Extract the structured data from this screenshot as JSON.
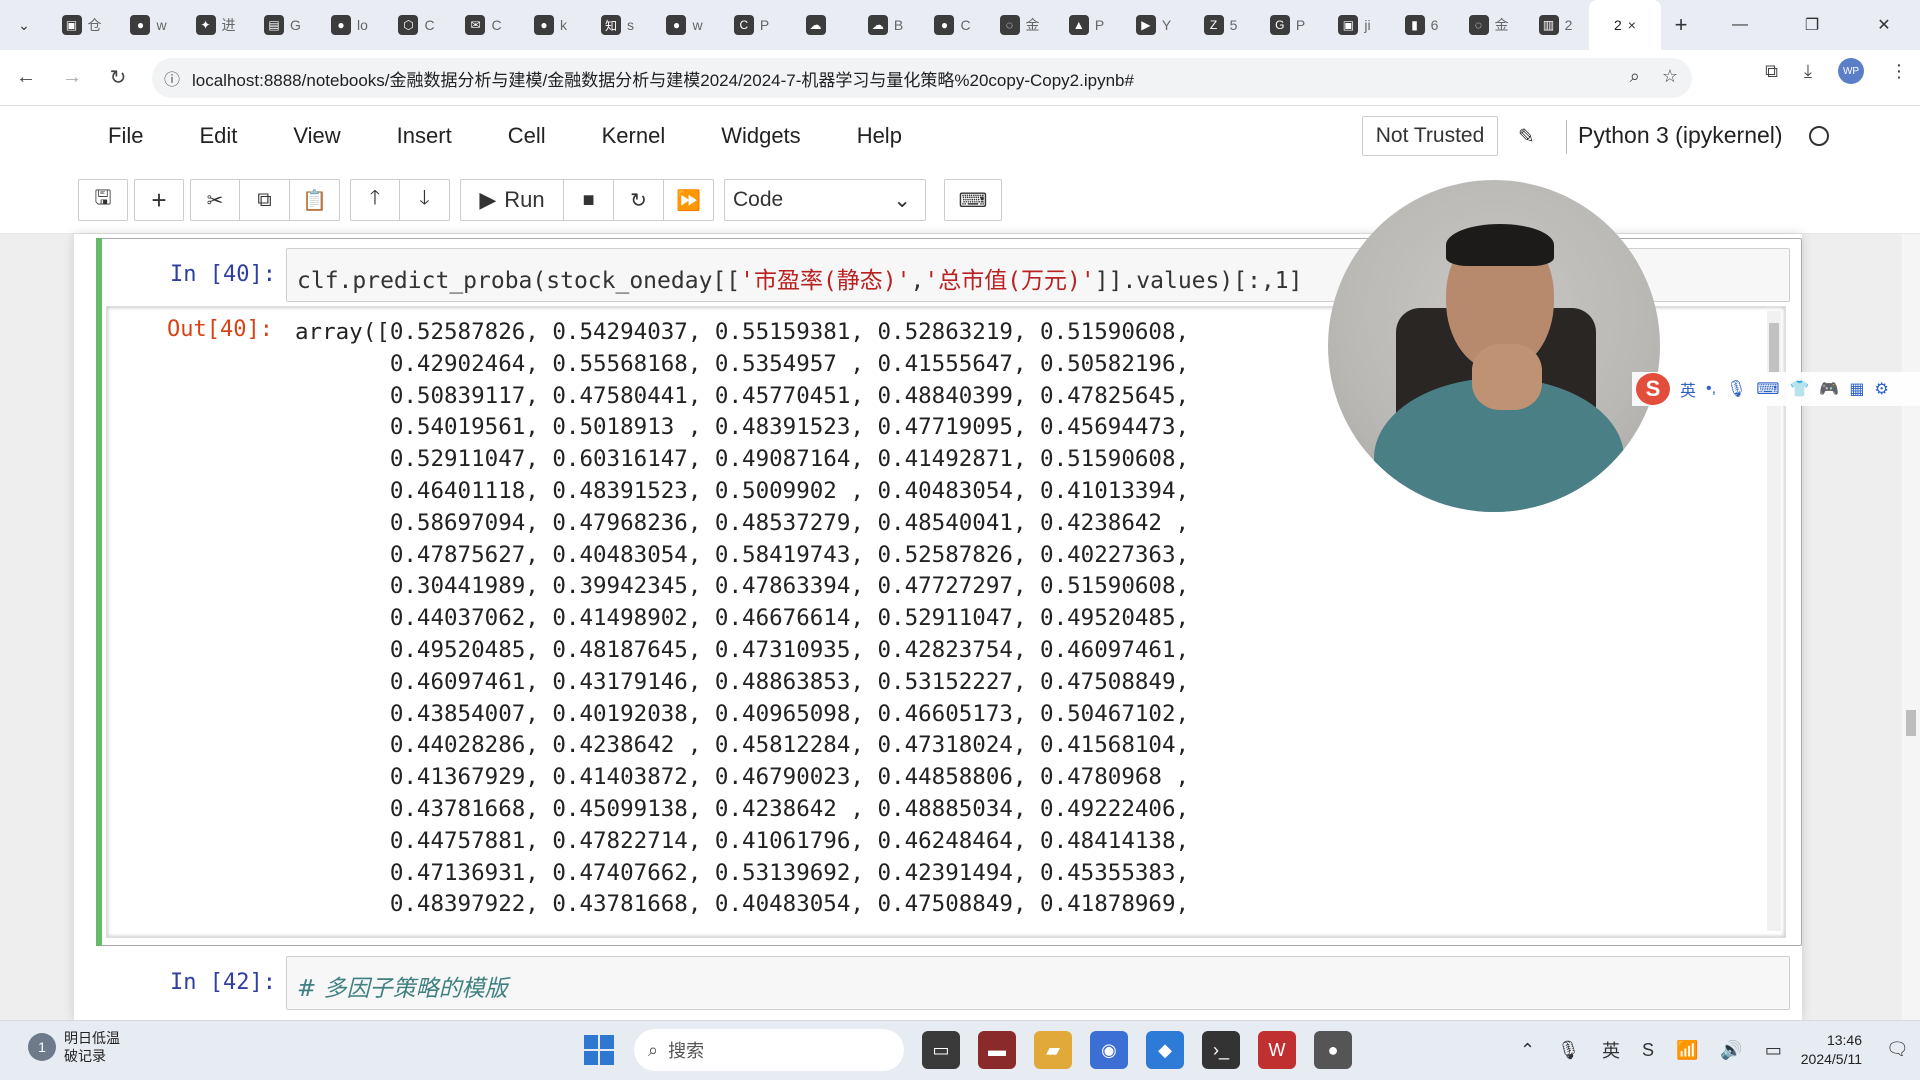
{
  "browser": {
    "tabs": [
      {
        "icon": "calendar",
        "label": "仓"
      },
      {
        "icon": "github",
        "label": "w"
      },
      {
        "icon": "tool",
        "label": "进"
      },
      {
        "icon": "generic",
        "label": "G"
      },
      {
        "icon": "github",
        "label": "lo"
      },
      {
        "icon": "cube",
        "label": "C"
      },
      {
        "icon": "mail",
        "label": "C"
      },
      {
        "icon": "github",
        "label": "k"
      },
      {
        "icon": "zhi",
        "label": "s"
      },
      {
        "icon": "github",
        "label": "w"
      },
      {
        "icon": "c-logo",
        "label": "P"
      },
      {
        "icon": "cloud",
        "label": ""
      },
      {
        "icon": "cloud",
        "label": "B"
      },
      {
        "icon": "github",
        "label": "C"
      },
      {
        "icon": "loading",
        "label": "金"
      },
      {
        "icon": "school",
        "label": "P"
      },
      {
        "icon": "youtube",
        "label": "Y"
      },
      {
        "icon": "z-logo",
        "label": "5"
      },
      {
        "icon": "google",
        "label": "P"
      },
      {
        "icon": "calendar",
        "label": "ji"
      },
      {
        "icon": "chart",
        "label": "6"
      },
      {
        "icon": "loading",
        "label": "金"
      },
      {
        "icon": "book",
        "label": "2"
      }
    ],
    "active_tab": {
      "label": "2",
      "close": "×"
    },
    "new_tab": "+",
    "url": "localhost:8888/notebooks/金融数据分析与建模/金融数据分析与建模2024/2024-7-机器学习与量化策略%20copy-Copy2.ipynb#",
    "profile_initials": "WP"
  },
  "jupyter": {
    "menu": [
      "File",
      "Edit",
      "View",
      "Insert",
      "Cell",
      "Kernel",
      "Widgets",
      "Help"
    ],
    "trusted": "Not Trusted",
    "kernel": "Python 3 (ipykernel)",
    "run_label": "Run",
    "cell_type": "Code"
  },
  "cells": {
    "cell1": {
      "in_prompt": "In [40]:",
      "code_prefix": "clf.predict_proba(stock_oneday[[",
      "str1": "'市盈率(静态)'",
      "comma": ",",
      "str2": "'总市值(万元)'",
      "code_suffix": "]].values)[:,1]",
      "out_prompt": "Out[40]:",
      "output_lines": [
        "array([0.52587826, 0.54294037, 0.55159381, 0.52863219, 0.51590608,",
        "       0.42902464, 0.55568168, 0.5354957 , 0.41555647, 0.50582196,",
        "       0.50839117, 0.47580441, 0.45770451, 0.48840399, 0.47825645,",
        "       0.54019561, 0.5018913 , 0.48391523, 0.47719095, 0.45694473,",
        "       0.52911047, 0.60316147, 0.49087164, 0.41492871, 0.51590608,",
        "       0.46401118, 0.48391523, 0.5009902 , 0.40483054, 0.41013394,",
        "       0.58697094, 0.47968236, 0.48537279, 0.48540041, 0.4238642 ,",
        "       0.47875627, 0.40483054, 0.58419743, 0.52587826, 0.40227363,",
        "       0.30441989, 0.39942345, 0.47863394, 0.47727297, 0.51590608,",
        "       0.44037062, 0.41498902, 0.46676614, 0.52911047, 0.49520485,",
        "       0.49520485, 0.48187645, 0.47310935, 0.42823754, 0.46097461,",
        "       0.46097461, 0.43179146, 0.48863853, 0.53152227, 0.47508849,",
        "       0.43854007, 0.40192038, 0.40965098, 0.46605173, 0.50467102,",
        "       0.44028286, 0.4238642 , 0.45812284, 0.47318024, 0.41568104,",
        "       0.41367929, 0.41403872, 0.46790023, 0.44858806, 0.4780968 ,",
        "       0.43781668, 0.45099138, 0.4238642 , 0.48885034, 0.49222406,",
        "       0.44757881, 0.47822714, 0.41061796, 0.46248464, 0.48414138,",
        "       0.47136931, 0.47407662, 0.53139692, 0.42391494, 0.45355383,",
        "       0.48397922, 0.43781668, 0.40483054, 0.47508849, 0.41878969,"
      ]
    },
    "cell2": {
      "in_prompt": "In [42]:",
      "code": "# 多因子策略的模版"
    }
  },
  "ime": {
    "logo": "S",
    "lang": "英"
  },
  "taskbar": {
    "weather_line1": "明日低温",
    "weather_line2": "破记录",
    "weather_badge": "1",
    "search_placeholder": "搜索",
    "time": "13:46",
    "date": "2024/5/11"
  }
}
